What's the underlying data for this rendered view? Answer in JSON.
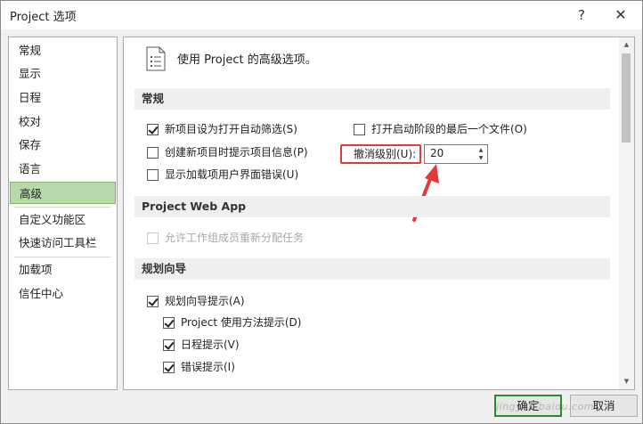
{
  "window": {
    "title": "Project 选项",
    "help": "?",
    "close": "✕"
  },
  "nav": {
    "items": [
      "常规",
      "显示",
      "日程",
      "校对",
      "保存",
      "语言",
      "高级",
      "自定义功能区",
      "快速访问工具栏",
      "加载项",
      "信任中心"
    ],
    "active": "高级"
  },
  "content": {
    "header": "使用 Project 的高级选项。",
    "sections": {
      "general": {
        "title": "常规",
        "options": [
          {
            "label": "新项目设为打开自动筛选(S)",
            "checked": true
          },
          {
            "label": "创建新项目时提示项目信息(P)",
            "checked": false
          },
          {
            "label": "显示加载项用户界面错误(U)",
            "checked": false
          },
          {
            "label": "打开启动阶段的最后一个文件(O)",
            "checked": false
          }
        ],
        "undo_label": "撤消级别(U):",
        "undo_value": "20"
      },
      "web_app": {
        "title": "Project Web App",
        "options": [
          {
            "label": "允许工作组成员重新分配任务",
            "checked": false,
            "disabled": true
          }
        ]
      },
      "planning": {
        "title": "规划向导",
        "options": [
          {
            "label": "规划向导提示(A)",
            "checked": true
          },
          {
            "label": "Project 使用方法提示(D)",
            "checked": true
          },
          {
            "label": "日程提示(V)",
            "checked": true
          },
          {
            "label": "错误提示(I)",
            "checked": true
          }
        ]
      }
    }
  },
  "buttons": {
    "ok": "确定",
    "cancel": "取消"
  },
  "watermark": "jingyan.baidu.com",
  "colors": {
    "active_nav": "#b7d9a9",
    "highlight": "#e03a3a",
    "ok_border": "#2a8b2a"
  }
}
